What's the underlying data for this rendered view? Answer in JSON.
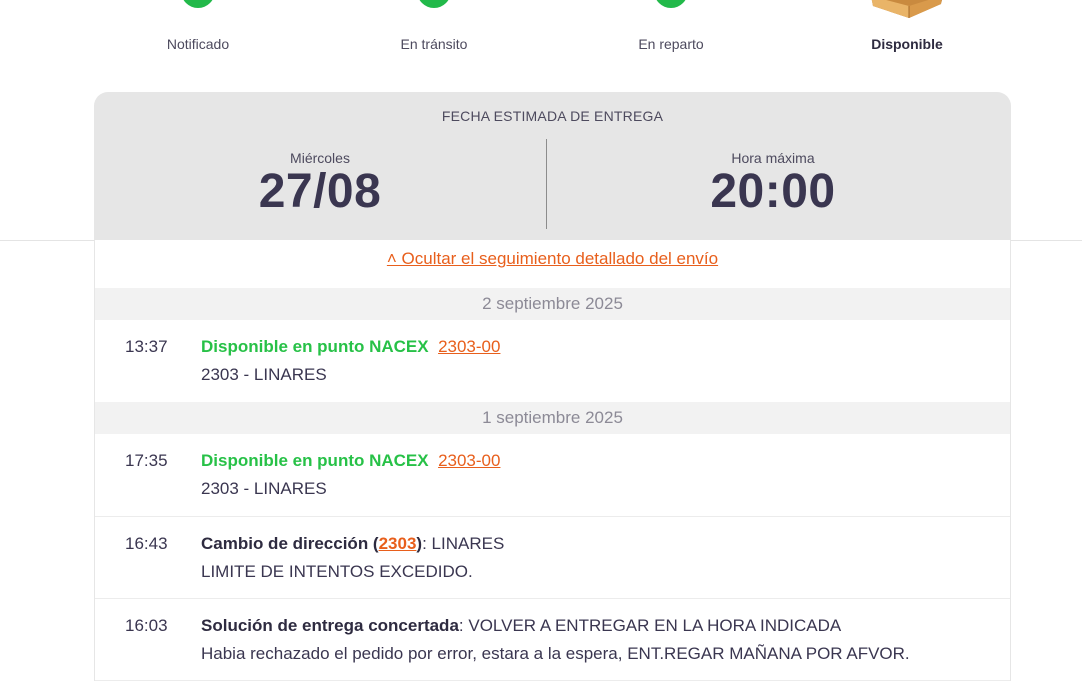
{
  "steps": [
    {
      "label": "Notificado",
      "done": true
    },
    {
      "label": "En tránsito",
      "done": true
    },
    {
      "label": "En reparto",
      "done": true
    },
    {
      "label": "Disponible",
      "active": true
    }
  ],
  "estimate": {
    "title": "FECHA ESTIMADA DE ENTREGA",
    "day_label": "Miércoles",
    "date": "27/08",
    "time_label": "Hora máxima",
    "time": "20:00"
  },
  "tracking": {
    "toggle_label": "˄ Ocultar el seguimiento detallado del envío",
    "groups": [
      {
        "date": "2 septiembre 2025",
        "events": [
          {
            "time": "13:37",
            "status": "Disponible en punto NACEX",
            "code": "2303-00",
            "detail": "2303 - LINARES"
          }
        ]
      },
      {
        "date": "1 septiembre 2025",
        "events": [
          {
            "time": "17:35",
            "status": "Disponible en punto NACEX",
            "code": "2303-00",
            "detail": "2303 - LINARES"
          },
          {
            "time": "16:43",
            "status_prefix": "Cambio de dirección (",
            "code": "2303",
            "status_suffix": ")",
            "inline_text": ": LINARES",
            "detail": "LIMITE DE INTENTOS EXCEDIDO."
          },
          {
            "time": "16:03",
            "status": "Solución de entrega concertada",
            "inline_text": ": VOLVER A ENTREGAR EN LA HORA INDICADA",
            "detail": "Habia rechazado el pedido por error, estara a la espera, ENT.REGAR MAÑANA POR AFVOR."
          }
        ]
      }
    ]
  },
  "colors": {
    "green": "#27c147",
    "orange": "#e85f1c",
    "text": "#3a3650",
    "card_bg": "#e6e6e6"
  },
  "icons": [
    "check-dot-icon",
    "package-box-icon"
  ]
}
